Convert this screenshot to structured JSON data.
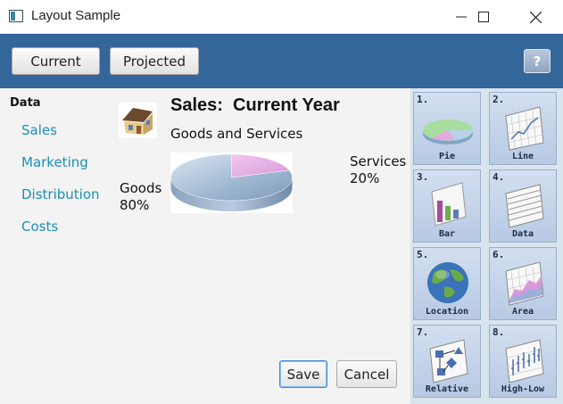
{
  "window": {
    "title": "Layout Sample"
  },
  "toolbar": {
    "current_label": "Current",
    "projected_label": "Projected",
    "help_label": "?"
  },
  "nav": {
    "title": "Data",
    "links": [
      "Sales",
      "Marketing",
      "Distribution",
      "Costs"
    ]
  },
  "main": {
    "title": "Sales:  Current Year",
    "subtitle": "Goods and Services",
    "goods_label": "Goods",
    "goods_pct": "80%",
    "services_label": "Services",
    "services_pct": "20%",
    "save_label": "Save",
    "cancel_label": "Cancel"
  },
  "chart_data": {
    "type": "pie",
    "categories": [
      "Goods",
      "Services"
    ],
    "values": [
      80,
      20
    ],
    "title": "Goods and Services"
  },
  "tiles": [
    {
      "num": "1.",
      "label": "Pie",
      "icon": "pie-chart-icon"
    },
    {
      "num": "2.",
      "label": "Line",
      "icon": "line-chart-icon"
    },
    {
      "num": "3.",
      "label": "Bar",
      "icon": "bar-chart-icon"
    },
    {
      "num": "4.",
      "label": "Data",
      "icon": "data-sheet-icon"
    },
    {
      "num": "5.",
      "label": "Location",
      "icon": "globe-icon"
    },
    {
      "num": "6.",
      "label": "Area",
      "icon": "area-chart-icon"
    },
    {
      "num": "7.",
      "label": "Relative",
      "icon": "flowchart-icon"
    },
    {
      "num": "8.",
      "label": "High-Low",
      "icon": "high-low-chart-icon"
    }
  ]
}
